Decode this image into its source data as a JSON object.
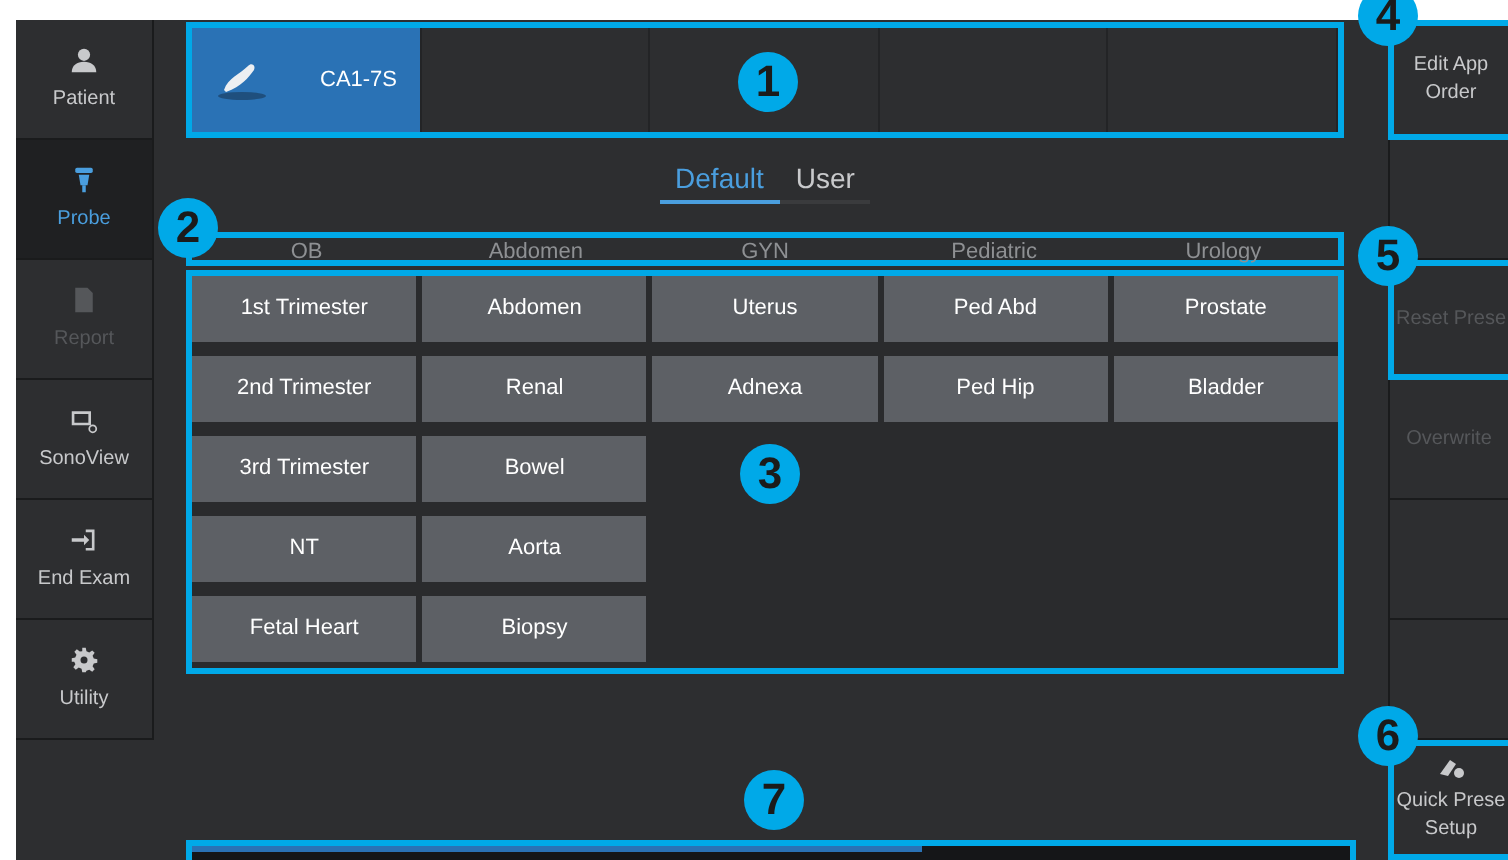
{
  "sidebar": {
    "items": [
      {
        "label": "Patient",
        "kind": "person",
        "selected": false,
        "disabled": false
      },
      {
        "label": "Probe",
        "kind": "probe",
        "selected": true,
        "disabled": false
      },
      {
        "label": "Report",
        "kind": "document",
        "selected": false,
        "disabled": true
      },
      {
        "label": "SonoView",
        "kind": "monitor",
        "selected": false,
        "disabled": false
      },
      {
        "label": "End Exam",
        "kind": "exit",
        "selected": false,
        "disabled": false
      },
      {
        "label": "Utility",
        "kind": "gear",
        "selected": false,
        "disabled": false
      }
    ]
  },
  "probe_bar": {
    "callout": "1",
    "slots": [
      {
        "label": "CA1-7S",
        "selected": true
      },
      {
        "selected": false
      },
      {
        "selected": false
      },
      {
        "selected": false
      },
      {
        "selected": false
      }
    ]
  },
  "preset_tabs": [
    {
      "label": "Default",
      "selected": true
    },
    {
      "label": "User",
      "selected": false
    }
  ],
  "categories": {
    "callout": "2",
    "items": [
      "OB",
      "Abdomen",
      "GYN",
      "Pediatric",
      "Urology"
    ]
  },
  "presets": {
    "callout": "3",
    "columns": [
      [
        "1st Trimester",
        "2nd Trimester",
        "3rd Trimester",
        "NT",
        "Fetal Heart"
      ],
      [
        "Abdomen",
        "Renal",
        "Bowel",
        "Aorta",
        "Biopsy"
      ],
      [
        "Uterus",
        "Adnexa"
      ],
      [
        "Ped Abd",
        "Ped Hip"
      ],
      [
        "Prostate",
        "Bladder"
      ]
    ]
  },
  "right_panel": [
    {
      "kind": "button",
      "label": "Edit App\nOrder",
      "disabled": false,
      "callout": "4"
    },
    {
      "kind": "blank"
    },
    {
      "kind": "button",
      "label": "Reset Prese",
      "disabled": true,
      "callout": "5"
    },
    {
      "kind": "button",
      "label": "Overwrite",
      "disabled": true
    },
    {
      "kind": "blank"
    },
    {
      "kind": "blank"
    },
    {
      "kind": "icon-button",
      "label": "Quick Prese\nSetup",
      "disabled": false,
      "callout": "6"
    }
  ],
  "bottom_panel": {
    "callout": "7",
    "level": 0.63
  }
}
